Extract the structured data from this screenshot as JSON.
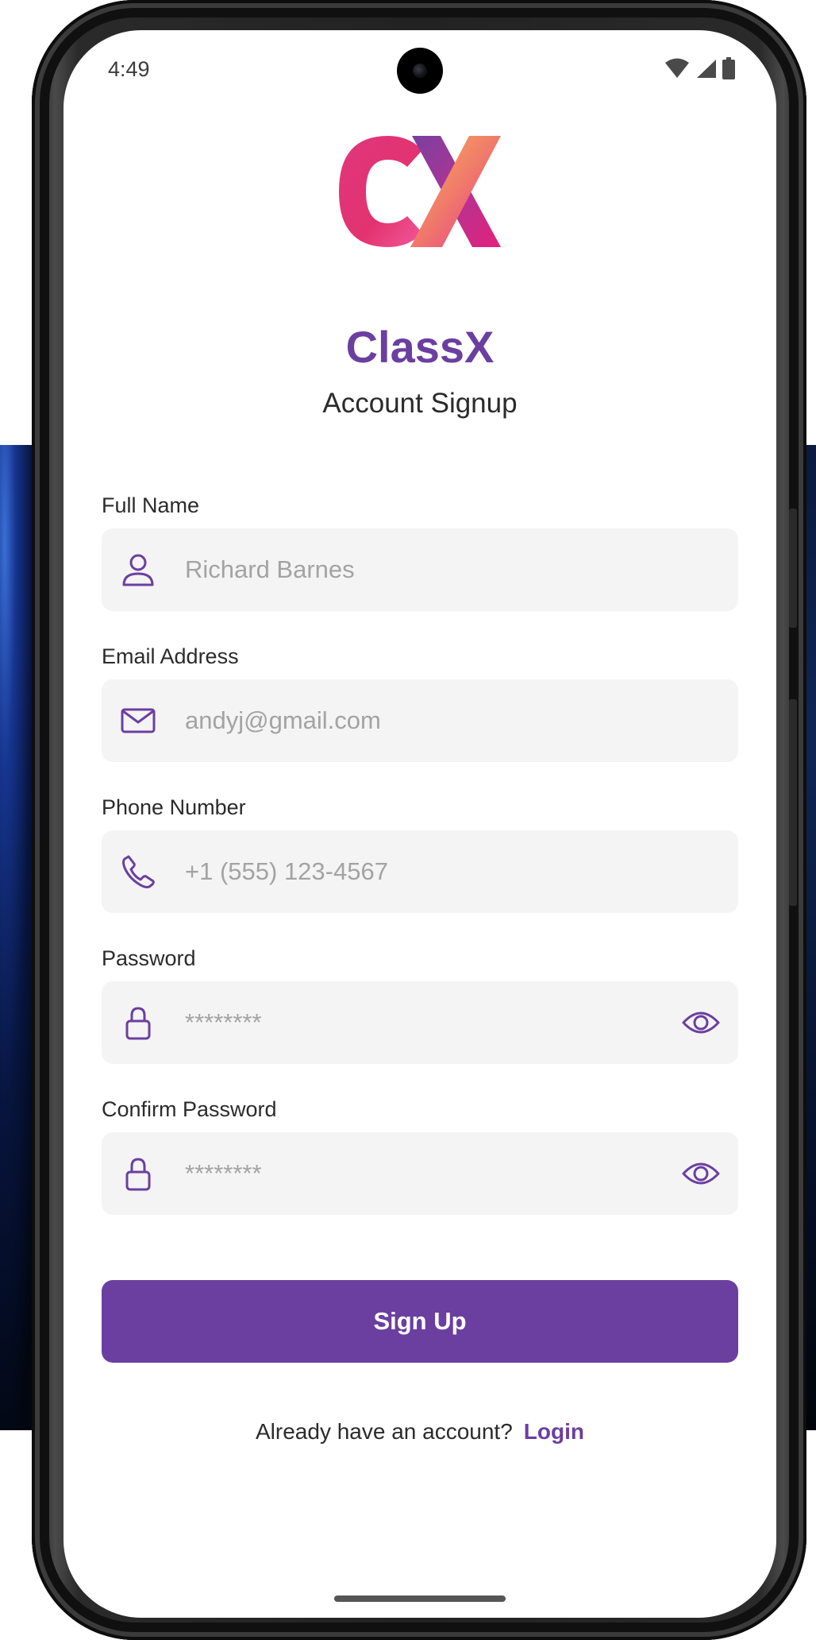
{
  "status_bar": {
    "time": "4:49"
  },
  "app": {
    "name": "ClassX",
    "subtitle": "Account Signup",
    "brand_color": "#6b3fa0"
  },
  "form": {
    "fields": [
      {
        "label": "Full Name",
        "placeholder": "Richard Barnes",
        "icon": "person-icon"
      },
      {
        "label": "Email Address",
        "placeholder": "andyj@gmail.com",
        "icon": "mail-icon"
      },
      {
        "label": "Phone Number",
        "placeholder": "+1 (555) 123-4567",
        "icon": "phone-icon"
      },
      {
        "label": "Password",
        "placeholder": "********",
        "icon": "lock-icon",
        "toggle_icon": "eye-icon"
      },
      {
        "label": "Confirm Password",
        "placeholder": "********",
        "icon": "lock-icon",
        "toggle_icon": "eye-icon"
      }
    ],
    "submit_label": "Sign Up"
  },
  "footer": {
    "prompt": "Already have an account?",
    "login_label": "Login"
  }
}
